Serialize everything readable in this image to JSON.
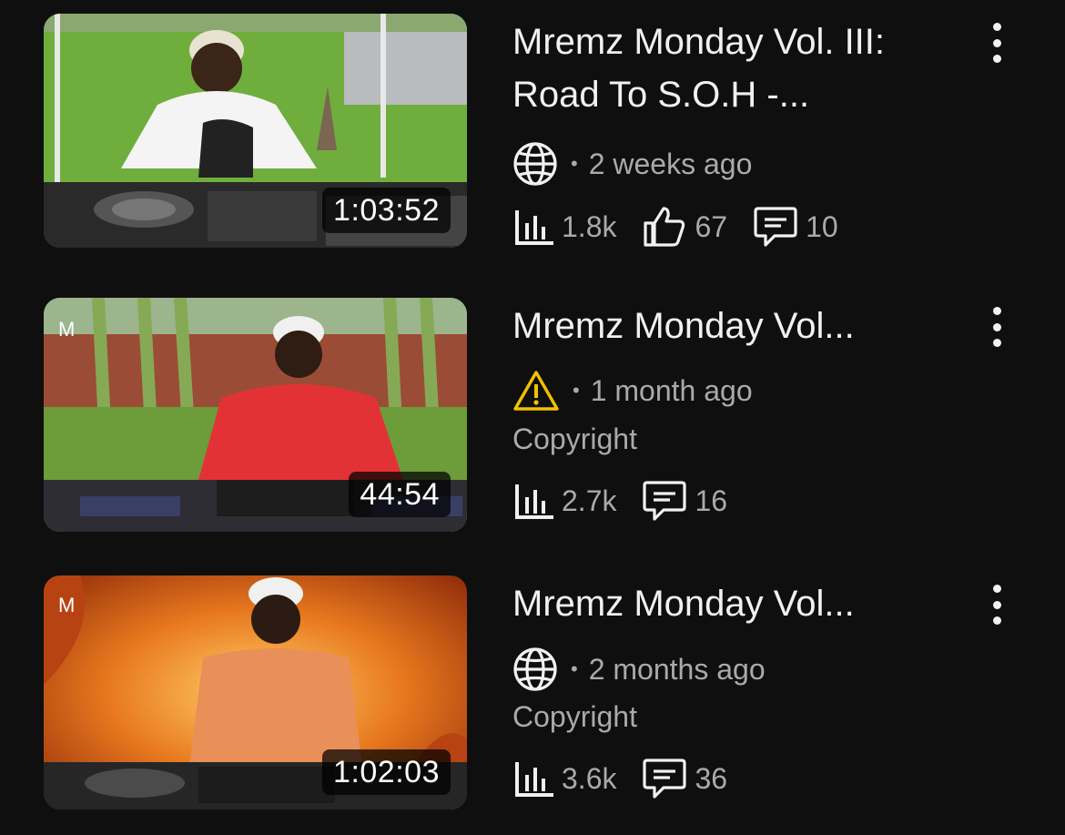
{
  "videos": [
    {
      "title": "Mremz Monday Vol. III: Road To S.O.H -...",
      "duration": "1:03:52",
      "visibility_icon": "globe-icon",
      "age": "2 weeks ago",
      "views": "1.8k",
      "likes": "67",
      "comments": "10"
    },
    {
      "title": "Mremz Monday Vol...",
      "duration": "44:54",
      "visibility_icon": "warning-icon",
      "age": "1 month ago",
      "restriction": "Copyright",
      "views": "2.7k",
      "comments": "16"
    },
    {
      "title": "Mremz Monday Vol...",
      "duration": "1:02:03",
      "visibility_icon": "globe-icon",
      "age": "2 months ago",
      "restriction": "Copyright",
      "views": "3.6k",
      "comments": "36"
    }
  ],
  "colors": {
    "background": "#0f0f0f",
    "primary_text": "#f1f1f1",
    "secondary_text": "#aaaaaa",
    "warning": "#f2c200"
  }
}
